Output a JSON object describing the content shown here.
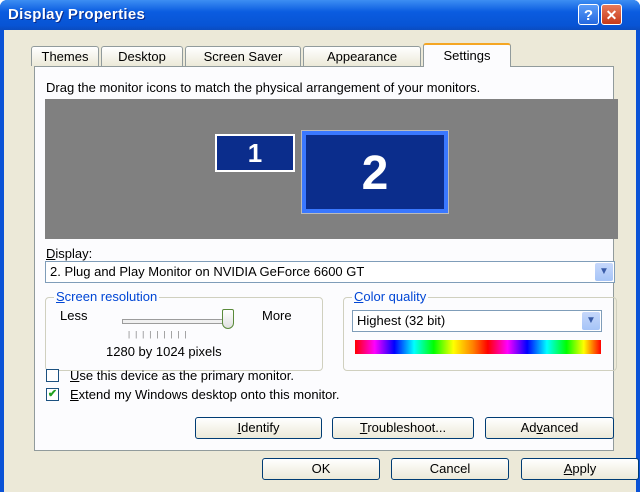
{
  "window": {
    "title": "Display Properties",
    "help_label": "?",
    "close_label": "✕"
  },
  "tabs": [
    "Themes",
    "Desktop",
    "Screen Saver",
    "Appearance",
    "Settings"
  ],
  "active_tab": "Settings",
  "instruction": "Drag the monitor icons to match the physical arrangement of your monitors.",
  "monitors": {
    "m1": "1",
    "m2": "2"
  },
  "display": {
    "label_u": "D",
    "label_rest": "isplay:",
    "value": "2. Plug and Play Monitor on NVIDIA GeForce 6600 GT"
  },
  "resolution": {
    "title_u": "S",
    "title_rest": "creen resolution",
    "less": "Less",
    "more": "More",
    "value": "1280 by 1024 pixels",
    "level": 1.0
  },
  "color_quality": {
    "title_u": "C",
    "title_rest": "olor quality",
    "value": "Highest (32 bit)"
  },
  "options": {
    "primary": {
      "u": "U",
      "rest": "se this device as the primary monitor.",
      "checked": false
    },
    "extend": {
      "u": "E",
      "rest": "xtend my Windows desktop onto this monitor.",
      "checked": true
    }
  },
  "panel_buttons": {
    "identify_u": "I",
    "identify_rest": "dentify",
    "troubleshoot_u": "T",
    "troubleshoot_rest": "roubleshoot...",
    "advanced_pre": "Ad",
    "advanced_u": "v",
    "advanced_rest": "anced"
  },
  "dialog_buttons": {
    "ok": "OK",
    "cancel": "Cancel",
    "apply_u": "A",
    "apply_rest": "pply"
  }
}
